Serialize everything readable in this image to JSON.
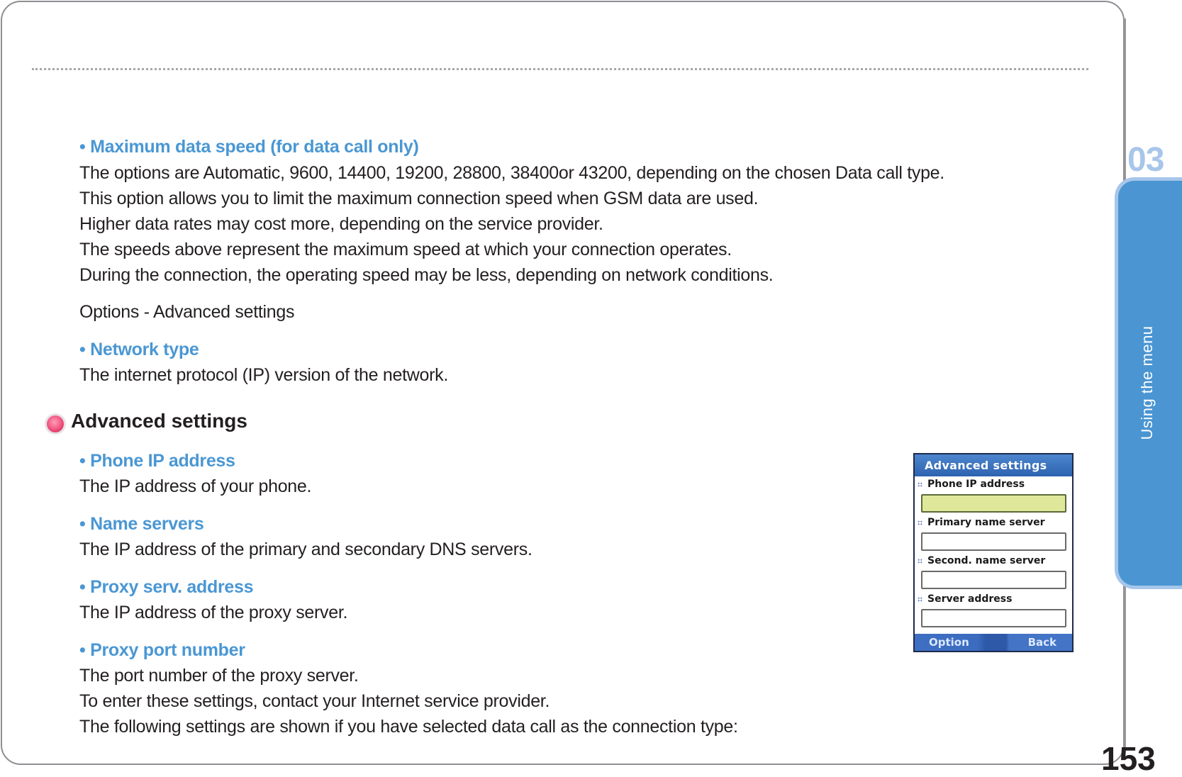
{
  "chapter": {
    "number": "03",
    "tab_label": "Using the menu"
  },
  "page_number": "153",
  "content": {
    "max_speed": {
      "heading": "• Maximum data speed (for data call only)",
      "lines": [
        "The options are Automatic, 9600, 14400, 19200, 28800, 38400or 43200, depending on the chosen Data call type.",
        "This option allows you to limit the maximum connection speed when GSM data are used.",
        "Higher data rates may cost more, depending on the service provider.",
        "The speeds above represent the maximum speed at which your connection operates.",
        "During the connection, the operating speed may be less, depending on network conditions."
      ]
    },
    "options_path": "Options - Advanced settings",
    "network_type": {
      "heading": "• Network type",
      "text": "The internet protocol (IP) version of the network."
    },
    "section_title": "Advanced settings",
    "phone_ip": {
      "heading": "• Phone IP address",
      "text": "The IP address of your phone."
    },
    "name_servers": {
      "heading": "• Name servers",
      "text": "The IP address of the primary and secondary DNS servers."
    },
    "proxy_address": {
      "heading": "• Proxy serv. address",
      "text": "The IP address of the proxy server."
    },
    "proxy_port": {
      "heading": "• Proxy port number",
      "lines": [
        "The port number of the proxy server.",
        "To enter these settings, contact your Internet service provider.",
        "The following settings are shown if you have selected data call as the connection type:"
      ]
    }
  },
  "phone_screen": {
    "title": "Advanced  settings",
    "fields": [
      {
        "label": "Phone IP address",
        "value": ""
      },
      {
        "label": "Primary name server",
        "value": ""
      },
      {
        "label": "Second. name server",
        "value": ""
      },
      {
        "label": "Server address",
        "value": ""
      }
    ],
    "softkey_left": "Option",
    "softkey_right": "Back"
  },
  "colors": {
    "accent_blue": "#4a97d3",
    "tab_blue": "#4a95d2",
    "tab_border": "#a6c6ea",
    "active_field": "#dfe89a",
    "bullet_pink": "#f0527e"
  }
}
